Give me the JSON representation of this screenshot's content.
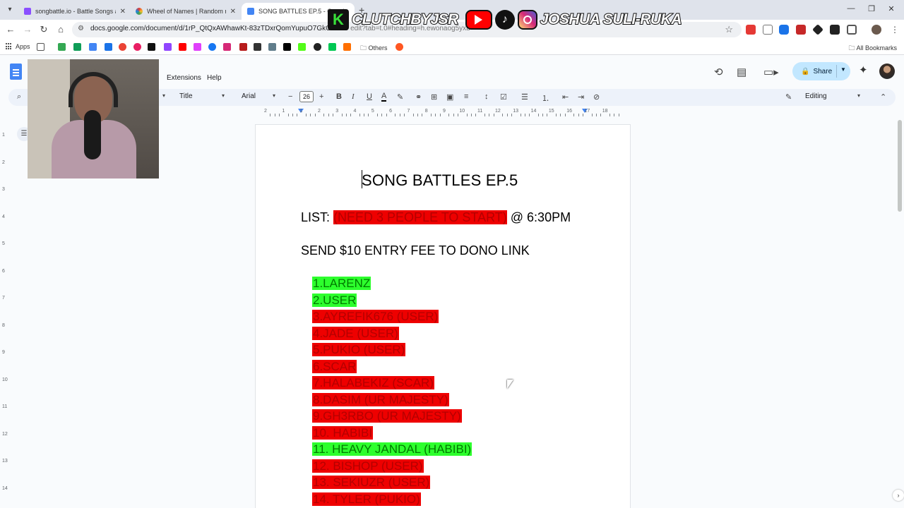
{
  "browser": {
    "tabs": [
      {
        "title": "songbattle.io - Battle Songs ag",
        "favicon_color": "#8a4fff",
        "active": false
      },
      {
        "title": "Wheel of Names | Random nam",
        "favicon_color": "#e53935",
        "active": false
      },
      {
        "title": "SONG BATTLES EP.5 - Google Docs",
        "favicon_color": "#4285f4",
        "active": true
      }
    ],
    "url": "docs.google.com/document/d/1rP_QtQxAWhawKt-83zTDxrQomYupuO7GkGzE4C",
    "url_tail": "edit?tab=t.0#heading=h.ewonaog5yxb",
    "bookmarks": {
      "apps_label": "Apps",
      "others_label": "Others",
      "all_label": "All Bookmarks"
    }
  },
  "overlay": {
    "brand": "CLUTCHBYJSR",
    "name": "JOSHUA SULI-RUKA",
    "k_glyph": "K",
    "tiktok_glyph": "♪"
  },
  "docs": {
    "menu": {
      "extensions": "Extensions",
      "help": "Help"
    },
    "share_label": "Share",
    "toolbar": {
      "style": "Title",
      "font": "Arial",
      "size": "26",
      "mode": "Editing"
    },
    "ruler_numbers": [
      "2",
      "1",
      "1",
      "2",
      "3",
      "4",
      "5",
      "6",
      "7",
      "8",
      "9",
      "10",
      "11",
      "12",
      "13",
      "14",
      "15",
      "16",
      "17",
      "18"
    ],
    "vruler_numbers": [
      "1",
      "2",
      "3",
      "4",
      "5",
      "6",
      "7",
      "8",
      "9",
      "10",
      "11",
      "12",
      "13",
      "14"
    ]
  },
  "document": {
    "title": "SONG BATTLES EP.5",
    "list_line": {
      "prefix": "LIST: ",
      "highlight": "(NEED 3 PEOPLE TO START)",
      "suffix": " @ 6:30PM"
    },
    "fee_line": "SEND $10 ENTRY FEE TO DONO LINK",
    "entries": [
      {
        "text": "1.LARENZ",
        "status": "green"
      },
      {
        "text": "2.USER",
        "status": "green"
      },
      {
        "text": "3.AYREFIK676 (USER)",
        "status": "red"
      },
      {
        "text": "4.JADE (USER)",
        "status": "red"
      },
      {
        "text": "5.PUKIO (USER)",
        "status": "red"
      },
      {
        "text": "6.SCAR",
        "status": "red"
      },
      {
        "text": "7.HALABEKIZ (SCAR)",
        "status": "red"
      },
      {
        "text": "8.DASIM (UR MAJESTY)",
        "status": "red"
      },
      {
        "text": "9.GH3RBO (UR MAJESTY)",
        "status": "red"
      },
      {
        "text": "10. HABIBI",
        "status": "red"
      },
      {
        "text": "11.  HEAVY JANDAL (HABIBI)",
        "status": "green"
      },
      {
        "text": "12.  BISHOP (USER)",
        "status": "red"
      },
      {
        "text": "13.  SEKIUZR (USER)",
        "status": "red"
      },
      {
        "text": "14.  TYLER (PUKIO)",
        "status": "red"
      }
    ]
  },
  "colors": {
    "highlight_red": "#ee0000",
    "highlight_green": "#2dff2d",
    "share_bg": "#c2e7ff",
    "toolbar_bg": "#edf2fa"
  }
}
